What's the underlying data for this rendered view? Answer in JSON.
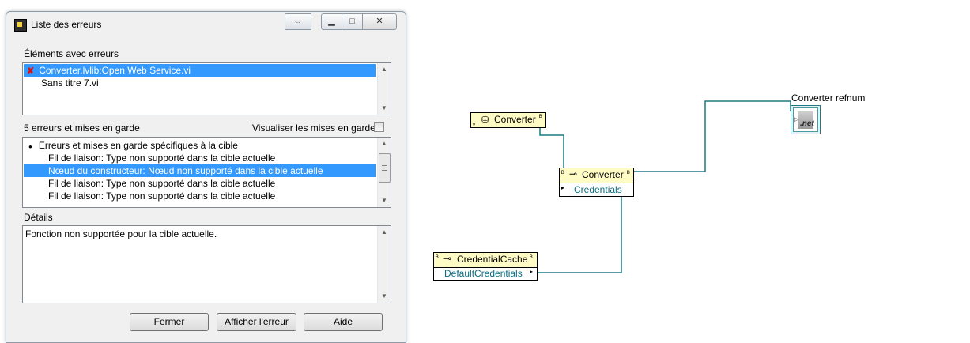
{
  "dialog": {
    "title": "Liste des erreurs",
    "titlebar_buttons": {
      "restore": "⇔",
      "minimize": "▁",
      "maximize": "□",
      "close": "✕"
    },
    "items_section_label": "Éléments avec erreurs",
    "items": [
      {
        "label": "Converter.lvlib:Open Web Service.vi",
        "selected": true,
        "error_icon": "✘"
      },
      {
        "label": "Sans titre 7.vi",
        "selected": false
      }
    ],
    "count_label": "5 erreurs et mises en garde",
    "show_warnings_label": "Visualiser les mises en garde",
    "show_warnings_checked": false,
    "errors": {
      "group_header": "Erreurs et mises en garde spécifiques à la cible",
      "bullet": "●",
      "rows": [
        {
          "text": "Fil de liaison: Type non supporté dans la cible actuelle",
          "selected": false
        },
        {
          "text": "Nœud du constructeur: Nœud non supporté dans la cible actuelle",
          "selected": true
        },
        {
          "text": "Fil de liaison: Type non supporté dans la cible actuelle",
          "selected": false
        },
        {
          "text": "Fil de liaison: Type non supporté dans la cible actuelle",
          "selected": false
        }
      ]
    },
    "details_label": "Détails",
    "details_text": "Fonction non supportée pour la cible actuelle.",
    "buttons": {
      "close": "Fermer",
      "show_error": "Afficher l'erreur",
      "help": "Aide"
    }
  },
  "diagram": {
    "wire_color": "#1d7a82",
    "constant_converter": {
      "label": "Converter",
      "icon": "class-constant-icon"
    },
    "constructor_node": {
      "label": "Converter",
      "property": "Credentials"
    },
    "credential_node": {
      "label": "CredentialCache",
      "property": "DefaultCredentials"
    },
    "indicator": {
      "label": "Converter refnum",
      "icon": "net-refnum-icon"
    }
  }
}
